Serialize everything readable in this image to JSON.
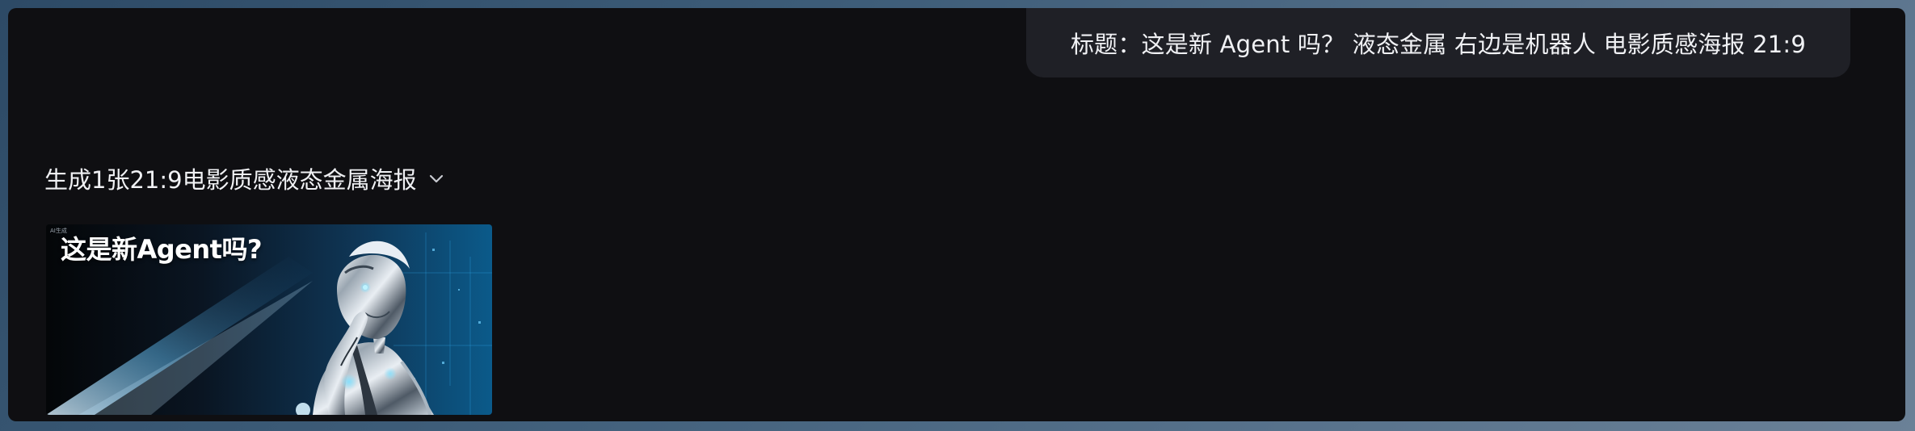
{
  "conversation": {
    "user_message": "标题：这是新 Agent 吗？ 液态金属 右边是机器人 电影质感海报 21:9",
    "assistant_reply_title": "生成1张21:9电影质感液态金属海报",
    "generated_image": {
      "poster_headline": "这是新Agent吗?",
      "corner_tag": "AI生成",
      "subject_icon": "liquid-metal-robot"
    }
  },
  "colors": {
    "window_background": "#0f0f12",
    "bubble_background": "#1f2026",
    "text": "#f0f1f4",
    "poster_accent": "#2fa6e8"
  }
}
